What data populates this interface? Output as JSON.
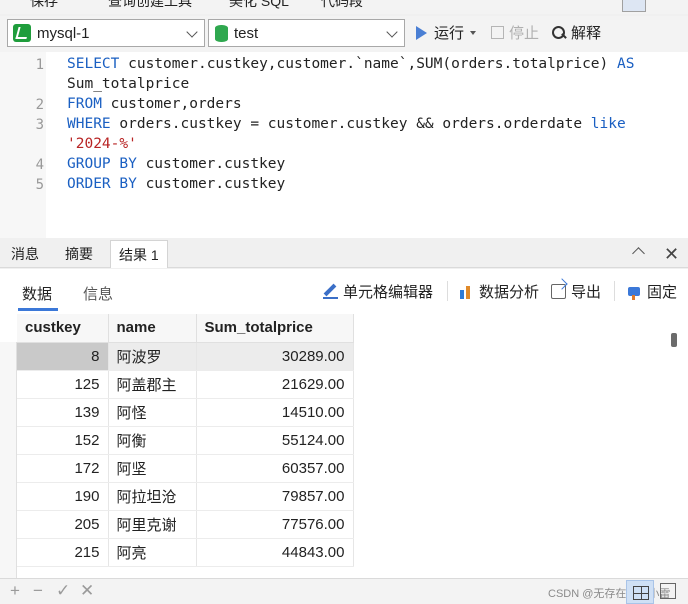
{
  "toolbar_top": {
    "save": "保存",
    "query_builder": "查询创建工具",
    "beautify_sql": "美化 SQL",
    "code_snippet": "代码段"
  },
  "selectors": {
    "connection": "mysql-1",
    "database": "test"
  },
  "actions": {
    "run": "运行",
    "stop": "停止",
    "explain": "解释"
  },
  "editor": {
    "line_numbers": [
      "1",
      "2",
      "3",
      "4",
      "5"
    ],
    "lines": [
      {
        "kw1": "SELECT",
        "rest": " customer.custkey,customer.`name`,SUM(orders.totalprice) ",
        "kw2": "AS"
      },
      {
        "cont": "Sum_totalprice"
      },
      {
        "kw1": "FROM",
        "rest": " customer,orders"
      },
      {
        "kw1": "WHERE",
        "rest": " orders.custkey = customer.custkey && orders.orderdate ",
        "kw2": "like"
      },
      {
        "str": "'2024-%'"
      },
      {
        "kw1": "GROUP BY",
        "rest": " customer.custkey"
      },
      {
        "kw1": "ORDER BY",
        "rest": " customer.custkey"
      }
    ]
  },
  "result_tabs": {
    "messages": "消息",
    "summary": "摘要",
    "result1": "结果 1"
  },
  "sub_tabs": {
    "data": "数据",
    "info": "信息"
  },
  "sub_tools": {
    "cell_editor": "单元格编辑器",
    "data_analysis": "数据分析",
    "export": "导出",
    "pin": "固定"
  },
  "table": {
    "columns": [
      "custkey",
      "name",
      "Sum_totalprice"
    ],
    "rows": [
      [
        "8",
        "阿波罗",
        "30289.00"
      ],
      [
        "125",
        "阿盖郡主",
        "21629.00"
      ],
      [
        "139",
        "阿怪",
        "14510.00"
      ],
      [
        "152",
        "阿衡",
        "55124.00"
      ],
      [
        "172",
        "阿坚",
        "60357.00"
      ],
      [
        "190",
        "阿拉坦沧",
        "79857.00"
      ],
      [
        "205",
        "阿里克谢",
        "77576.00"
      ],
      [
        "215",
        "阿亮",
        "44843.00"
      ]
    ]
  },
  "bottom": {
    "add": "+",
    "remove": "−",
    "apply": "✓",
    "discard": "✕",
    "watermark": "CSDN @无存在感的小雷"
  }
}
